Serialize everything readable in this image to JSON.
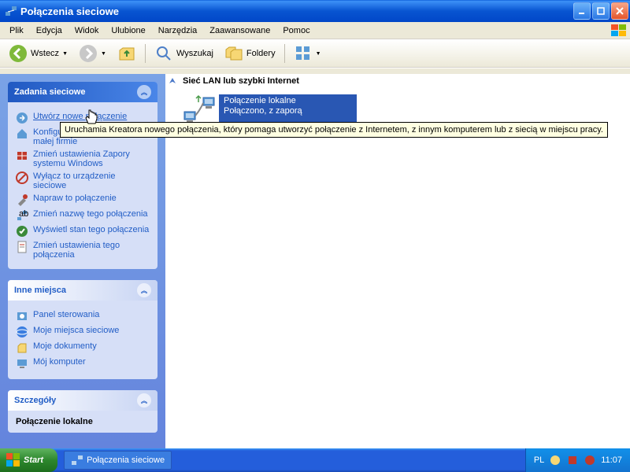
{
  "title": "Połączenia sieciowe",
  "menu": {
    "file": "Plik",
    "edit": "Edycja",
    "view": "Widok",
    "favorites": "Ulubione",
    "tools": "Narzędzia",
    "advanced": "Zaawansowane",
    "help": "Pomoc"
  },
  "toolbar": {
    "back": "Wstecz",
    "search": "Wyszukaj",
    "folders": "Foldery"
  },
  "sidebar": {
    "tasks_title": "Zadania sieciowe",
    "tasks": [
      "Utwórz nowe połączenie",
      "Konfiguruj sieć w domu lub w małej firmie",
      "Zmień ustawienia Zapory systemu Windows",
      "Wyłącz to urządzenie sieciowe",
      "Napraw to połączenie",
      "Zmień nazwę tego połączenia",
      "Wyświetl stan tego połączenia",
      "Zmień ustawienia tego połączenia"
    ],
    "other_title": "Inne miejsca",
    "other": [
      "Panel sterowania",
      "Moje miejsca sieciowe",
      "Moje dokumenty",
      "Mój komputer"
    ],
    "details_title": "Szczegóły",
    "details_name": "Połączenie lokalne"
  },
  "list": {
    "header": "Sieć LAN lub szybki Internet",
    "conn": {
      "name": "Połączenie lokalne",
      "status": "Połączono, z zaporą"
    }
  },
  "tooltip": "Uruchamia Kreatora nowego połączenia, który pomaga utworzyć połączenie z Internetem, z innym komputerem lub z siecią w miejscu pracy.",
  "taskbar": {
    "start": "Start",
    "item": "Połączenia sieciowe",
    "lang": "PL",
    "time": "11:07"
  }
}
